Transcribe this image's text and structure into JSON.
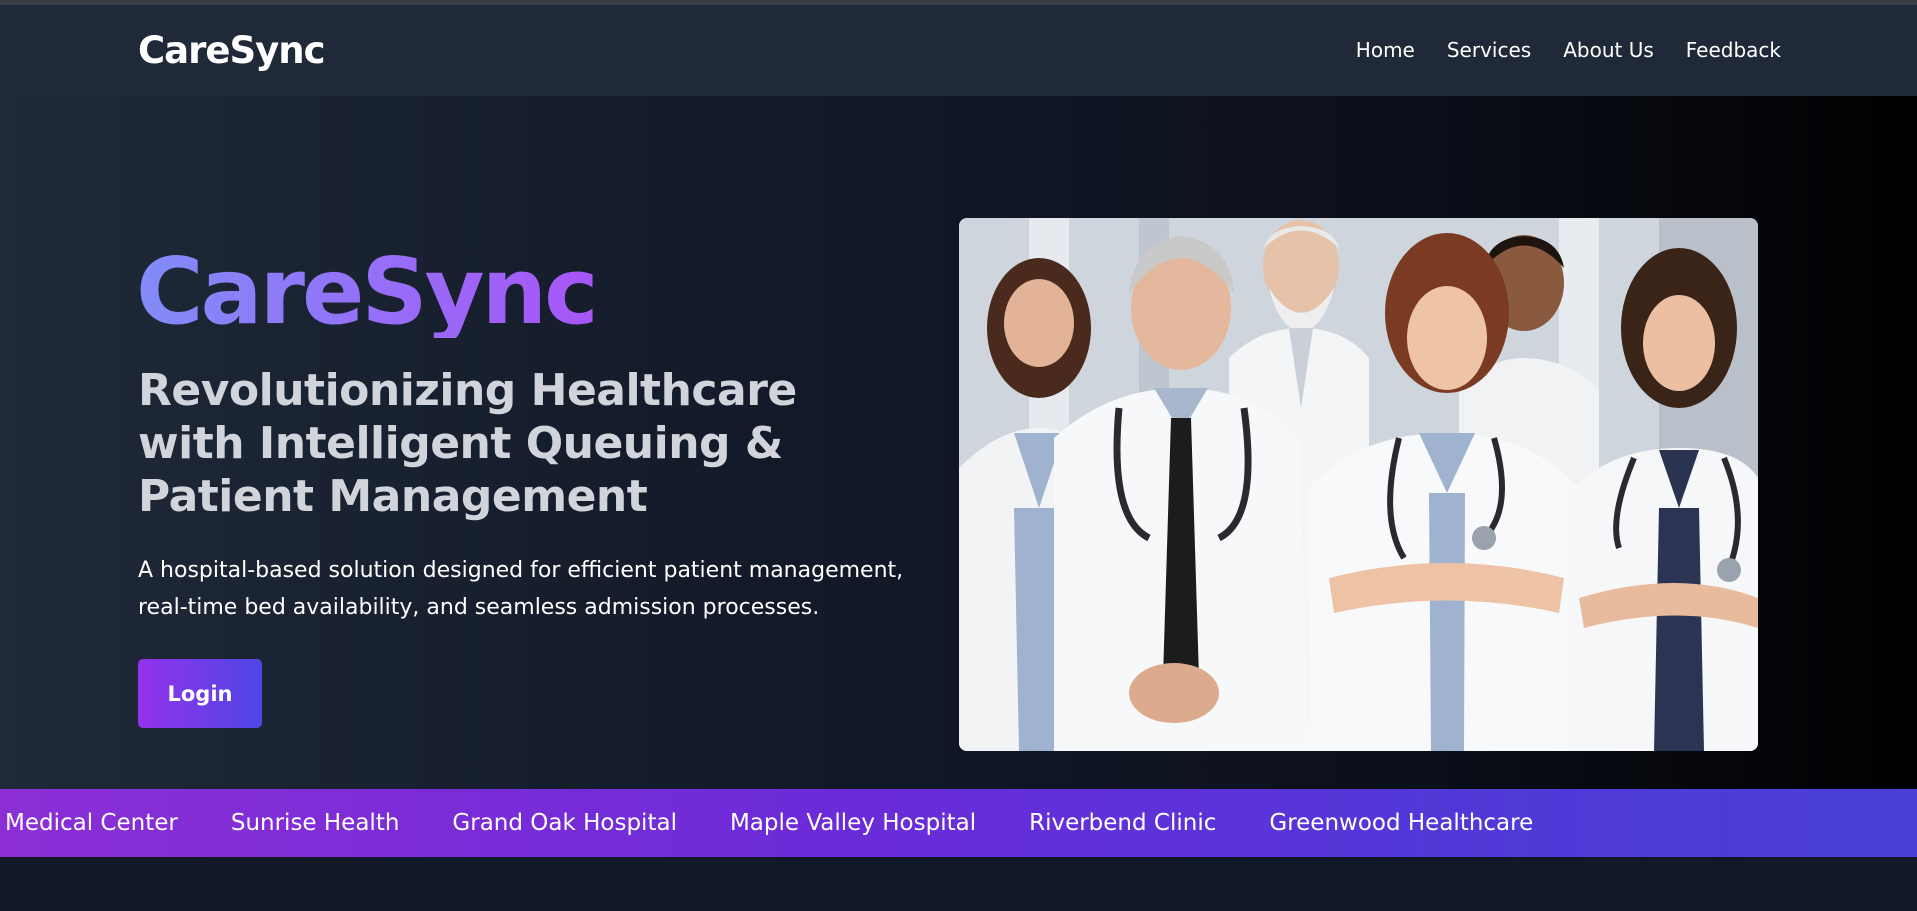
{
  "navbar": {
    "brand": "CareSync",
    "links": [
      "Home",
      "Services",
      "About Us",
      "Feedback"
    ]
  },
  "hero": {
    "title": "CareSync",
    "subtitle": "Revolutionizing Healthcare with Intelligent Queuing & Patient Management",
    "description": "A hospital-based solution designed for efficient patient management, real-time bed availability, and seamless admission processes.",
    "login_label": "Login",
    "image_icon": "doctors-team-photo"
  },
  "partners": [
    "Medical Center",
    "Sunrise Health",
    "Grand Oak Hospital",
    "Maple Valley Hospital",
    "Riverbend Clinic",
    "Greenwood Healthcare"
  ],
  "colors": {
    "navbar_bg": "#1f2937",
    "accent_from": "#9333ea",
    "accent_to": "#4f46e5",
    "title_from": "#818cf8",
    "title_to": "#a855f7"
  }
}
